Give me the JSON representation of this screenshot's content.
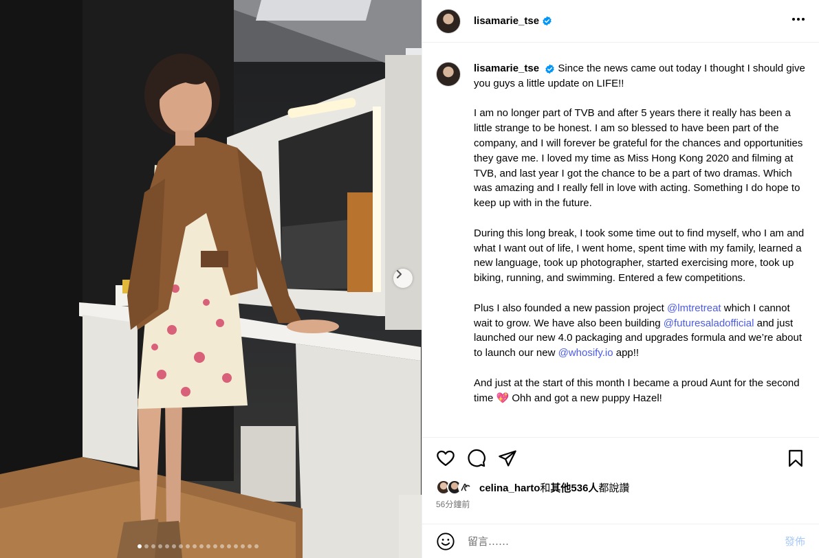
{
  "post": {
    "username": "lisamarie_tse",
    "verified": true,
    "caption_intro": "Since the news came out today I thought I should give you guys a little update on LIFE!!",
    "paragraph_2": "I am no longer part of TVB and after 5 years there it really has been a little strange to be honest. I am so blessed to have been part of the company, and I will forever be grateful for the chances and opportunities they gave me. I loved my time as Miss Hong Kong 2020 and filming at TVB, and last year I got the chance to be a part of two dramas. Which was amazing and I really fell in love with acting. Something I do hope to keep up with in the future.",
    "paragraph_3": "During this long break, I took some time out to find myself, who I am and what I want out of life, I went home, spent time with my family, learned a new language, took up photographer, started exercising more, took up biking, running, and swimming. Entered a few competitions.",
    "paragraph_4": {
      "part1": "Plus I also founded a new passion project ",
      "mention1": "@lmtretreat",
      "part2": " which I cannot wait to grow. We have also been building ",
      "mention2": "@futuresaladofficial",
      "part3": " and just launched our new 4.0 packaging and upgrades formula and we’re about to launch our new ",
      "mention3": "@whosify.io",
      "part4": " app!!"
    },
    "paragraph_5": {
      "text": "And just at the start of this month I became a proud Aunt for the second time ",
      "emoji": "💖",
      "text2": " Ohh and got a new puppy Hazel!"
    }
  },
  "likes": {
    "user": "celina_harto",
    "middle": "和",
    "others": "其他536人",
    "suffix": "都說讚"
  },
  "timestamp": "56分鐘前",
  "comment": {
    "placeholder": "留言……",
    "post_label": "發佈"
  },
  "carousel": {
    "total": 18,
    "current": 1
  },
  "colors": {
    "verified": "#0095f6",
    "mention": "#4b5be8",
    "post_disabled": "#a8c9f8",
    "meta_text": "#737373"
  },
  "icons": [
    "heart-icon",
    "comment-icon",
    "share-icon",
    "bookmark-icon",
    "emoji-icon",
    "more-icon",
    "chevron-right-icon",
    "verified-icon"
  ]
}
